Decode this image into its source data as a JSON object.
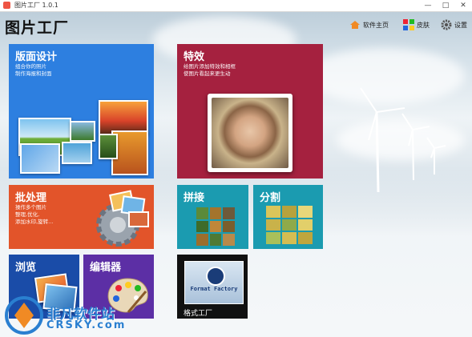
{
  "window": {
    "title": "图片工厂 1.0.1",
    "minimize": "—",
    "maximize": "□",
    "close": "✕"
  },
  "app": {
    "name": "图片工厂"
  },
  "topnav": {
    "home_label": "软件主页",
    "skin_label": "皮肤",
    "settings_label": "设置"
  },
  "tiles": {
    "design": {
      "title": "版面设计",
      "desc1": "组合你的照片",
      "desc2": "制作海报和封面"
    },
    "effects": {
      "title": "特效",
      "desc1": "给图片添加特效和相框",
      "desc2": "使图片看起来更生动"
    },
    "batch": {
      "title": "批处理",
      "desc1": "操作多个图片",
      "desc2": "整理,优化,",
      "desc3": "添加水印,旋转..."
    },
    "stitch": {
      "title": "拼接"
    },
    "split": {
      "title": "分割"
    },
    "browse": {
      "title": "浏览"
    },
    "editor": {
      "title": "编辑器"
    },
    "formatfactory": {
      "label": "格式工厂",
      "logo_text": "Format Factory"
    }
  },
  "watermark": {
    "line1": "非凡软件站",
    "line2": "CRSKY.com"
  },
  "colors": {
    "design": "#2d7fe0",
    "effects": "#a5213f",
    "batch": "#e2542a",
    "stitch": "#1b9bb0",
    "split": "#1b9bb0",
    "browse": "#1a4ca8",
    "editor": "#5c2fa5"
  }
}
